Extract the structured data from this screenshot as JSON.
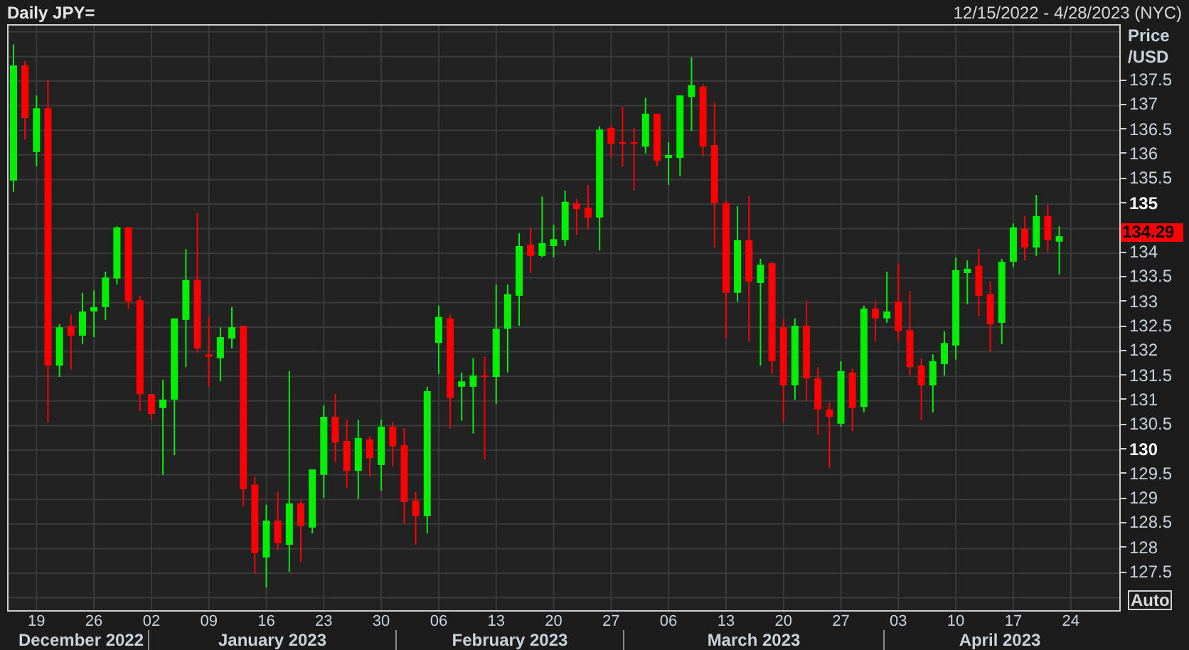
{
  "header": {
    "title": "Daily JPY=",
    "date_range": "12/15/2022 - 4/28/2023 (NYC)"
  },
  "chart": {
    "chart_data": {
      "type": "candlestick",
      "ylim": [
        126.75,
        138.63
      ],
      "grid": true,
      "categories": [
        null,
        null,
        "19",
        null,
        null,
        null,
        null,
        "26",
        null,
        null,
        null,
        null,
        "02",
        null,
        null,
        null,
        null,
        "09",
        null,
        null,
        null,
        null,
        "16",
        null,
        null,
        null,
        null,
        "23",
        null,
        null,
        null,
        null,
        "30",
        null,
        null,
        null,
        null,
        "06",
        null,
        null,
        null,
        null,
        "13",
        null,
        null,
        null,
        null,
        "20",
        null,
        null,
        null,
        null,
        "27",
        null,
        null,
        null,
        null,
        "06",
        null,
        null,
        null,
        null,
        "13",
        null,
        null,
        null,
        null,
        "20",
        null,
        null,
        null,
        null,
        "27",
        null,
        null,
        null,
        null,
        "03",
        null,
        null,
        null,
        null,
        "10",
        null,
        null,
        null,
        null,
        "17",
        null,
        null,
        null,
        null,
        "24"
      ],
      "yticks": [
        {
          "value": 137.5,
          "label": "137.5"
        },
        {
          "value": 137,
          "label": "137"
        },
        {
          "value": 136.5,
          "label": "136.5"
        },
        {
          "value": 136,
          "label": "136"
        },
        {
          "value": 135.5,
          "label": "135.5"
        },
        {
          "value": 135,
          "label": "135"
        },
        {
          "value": 134,
          "label": "134"
        },
        {
          "value": 133.5,
          "label": "133.5"
        },
        {
          "value": 133,
          "label": "133"
        },
        {
          "value": 132.5,
          "label": "132.5"
        },
        {
          "value": 132,
          "label": "132"
        },
        {
          "value": 131.5,
          "label": "131.5"
        },
        {
          "value": 131,
          "label": "131"
        },
        {
          "value": 130.5,
          "label": "130.5"
        },
        {
          "value": 130,
          "label": "130"
        },
        {
          "value": 129.5,
          "label": "129.5"
        },
        {
          "value": 129,
          "label": "129"
        },
        {
          "value": 128.5,
          "label": "128.5"
        },
        {
          "value": 128,
          "label": "128"
        },
        {
          "value": 127.5,
          "label": "127.5"
        }
      ],
      "ohlc": [
        [
          135.48,
          138.25,
          135.25,
          137.82
        ],
        [
          137.82,
          137.91,
          136.32,
          136.75
        ],
        [
          136.06,
          137.21,
          135.77,
          136.95
        ],
        [
          136.95,
          137.53,
          130.57,
          131.72
        ],
        [
          131.72,
          132.56,
          131.49,
          132.5
        ],
        [
          132.53,
          132.76,
          131.64,
          132.33
        ],
        [
          132.33,
          133.2,
          132.16,
          132.82
        ],
        [
          132.82,
          133.25,
          132.3,
          132.91
        ],
        [
          132.91,
          133.63,
          132.65,
          133.51
        ],
        [
          133.49,
          134.55,
          133.37,
          134.53
        ],
        [
          134.53,
          134.53,
          132.88,
          133.02
        ],
        [
          133.05,
          133.14,
          130.8,
          131.14
        ],
        [
          131.14,
          131.14,
          130.62,
          130.74
        ],
        [
          130.86,
          131.43,
          129.5,
          131.03
        ],
        [
          131.03,
          132.68,
          129.9,
          132.68
        ],
        [
          132.65,
          134.09,
          131.69,
          133.46
        ],
        [
          133.46,
          134.82,
          131.98,
          132.07
        ],
        [
          131.95,
          132.71,
          131.29,
          131.9
        ],
        [
          131.87,
          132.5,
          131.4,
          132.3
        ],
        [
          132.27,
          132.91,
          132.07,
          132.5
        ],
        [
          132.53,
          132.53,
          128.86,
          129.21
        ],
        [
          129.3,
          129.47,
          127.49,
          127.91
        ],
        [
          127.82,
          128.89,
          127.21,
          128.57
        ],
        [
          128.57,
          129.15,
          127.97,
          128.11
        ],
        [
          128.08,
          131.61,
          127.53,
          128.92
        ],
        [
          128.92,
          128.98,
          127.73,
          128.46
        ],
        [
          128.43,
          129.61,
          128.31,
          129.61
        ],
        [
          129.5,
          130.91,
          129.03,
          130.68
        ],
        [
          130.68,
          131.14,
          129.76,
          130.16
        ],
        [
          130.19,
          130.62,
          129.24,
          129.58
        ],
        [
          129.58,
          130.62,
          129.01,
          130.25
        ],
        [
          130.22,
          130.28,
          129.47,
          129.84
        ],
        [
          129.7,
          130.62,
          129.18,
          130.48
        ],
        [
          130.48,
          130.57,
          129.67,
          130.08
        ],
        [
          130.1,
          130.45,
          128.51,
          128.95
        ],
        [
          128.98,
          129.15,
          128.08,
          128.66
        ],
        [
          128.66,
          131.29,
          128.31,
          131.2
        ],
        [
          132.18,
          132.94,
          131.55,
          132.71
        ],
        [
          132.68,
          132.76,
          130.45,
          131.06
        ],
        [
          131.29,
          131.58,
          130.6,
          131.4
        ],
        [
          131.29,
          131.87,
          130.34,
          131.52
        ],
        [
          131.52,
          131.9,
          129.81,
          131.49
        ],
        [
          131.49,
          133.37,
          130.94,
          132.47
        ],
        [
          132.47,
          133.37,
          131.58,
          133.17
        ],
        [
          133.14,
          134.41,
          132.53,
          134.15
        ],
        [
          134.18,
          134.53,
          133.6,
          133.95
        ],
        [
          133.95,
          135.16,
          133.92,
          134.21
        ],
        [
          134.15,
          134.58,
          133.92,
          134.29
        ],
        [
          134.27,
          135.28,
          134.15,
          135.05
        ],
        [
          135.02,
          135.11,
          134.38,
          134.9
        ],
        [
          134.93,
          135.39,
          134.5,
          134.73
        ],
        [
          134.73,
          136.58,
          134.06,
          136.52
        ],
        [
          136.55,
          136.61,
          135.94,
          136.23
        ],
        [
          136.26,
          136.98,
          135.77,
          136.23
        ],
        [
          136.26,
          136.55,
          135.28,
          136.23
        ],
        [
          136.17,
          137.16,
          136.03,
          136.84
        ],
        [
          136.84,
          136.84,
          135.77,
          135.88
        ],
        [
          135.94,
          136.26,
          135.39,
          136.0
        ],
        [
          135.94,
          137.21,
          135.57,
          137.21
        ],
        [
          137.18,
          137.99,
          136.49,
          137.42
        ],
        [
          137.39,
          137.44,
          135.97,
          136.17
        ],
        [
          136.2,
          137.07,
          134.12,
          135.02
        ],
        [
          135.02,
          135.07,
          132.27,
          133.2
        ],
        [
          133.2,
          134.96,
          133.02,
          134.27
        ],
        [
          134.27,
          135.16,
          132.21,
          133.43
        ],
        [
          133.4,
          133.89,
          131.72,
          133.77
        ],
        [
          133.8,
          133.83,
          131.55,
          131.81
        ],
        [
          132.5,
          132.68,
          130.57,
          131.32
        ],
        [
          131.32,
          132.68,
          131.03,
          132.53
        ],
        [
          132.53,
          133.05,
          131.0,
          131.46
        ],
        [
          131.46,
          131.69,
          130.31,
          130.83
        ],
        [
          130.83,
          130.97,
          129.64,
          130.68
        ],
        [
          130.54,
          131.81,
          130.48,
          131.61
        ],
        [
          131.58,
          131.66,
          130.39,
          130.86
        ],
        [
          130.88,
          132.94,
          130.77,
          132.88
        ],
        [
          132.88,
          133.03,
          132.21,
          132.68
        ],
        [
          132.68,
          133.63,
          132.59,
          132.82
        ],
        [
          133.02,
          133.8,
          132.21,
          132.42
        ],
        [
          132.44,
          133.23,
          131.52,
          131.69
        ],
        [
          131.72,
          131.87,
          130.62,
          131.32
        ],
        [
          131.32,
          131.95,
          130.77,
          131.81
        ],
        [
          131.75,
          132.42,
          131.52,
          132.18
        ],
        [
          132.13,
          133.92,
          131.84,
          133.66
        ],
        [
          133.6,
          133.86,
          132.97,
          133.69
        ],
        [
          133.75,
          134.09,
          132.73,
          133.14
        ],
        [
          133.17,
          133.43,
          132.01,
          132.56
        ],
        [
          132.59,
          133.89,
          132.16,
          133.83
        ],
        [
          133.83,
          134.61,
          133.72,
          134.53
        ],
        [
          134.5,
          134.76,
          133.86,
          134.12
        ],
        [
          134.12,
          135.19,
          133.95,
          134.76
        ],
        [
          134.76,
          134.99,
          134.03,
          134.27
        ],
        [
          134.24,
          134.55,
          133.57,
          134.35
        ],
        null
      ]
    }
  },
  "price_axis": {
    "label_line_1": "Price",
    "label_line_2": "/USD",
    "current_price": "134.29",
    "scale_button": "Auto",
    "tick_styles": [
      {
        "major": false
      },
      {
        "major": false
      },
      {
        "major": false
      },
      {
        "major": false
      },
      {
        "major": false
      },
      {
        "major": true
      },
      {
        "major": false
      },
      {
        "major": false
      },
      {
        "major": false
      },
      {
        "major": false
      },
      {
        "major": false
      },
      {
        "major": false
      },
      {
        "major": false
      },
      {
        "major": false
      },
      {
        "major": true
      },
      {
        "major": false
      },
      {
        "major": false
      },
      {
        "major": false
      },
      {
        "major": false
      },
      {
        "major": false
      }
    ]
  },
  "date_axis": {
    "months": [
      "December 2022",
      "January 2023",
      "February 2023",
      "March 2023",
      "April 2023"
    ]
  }
}
